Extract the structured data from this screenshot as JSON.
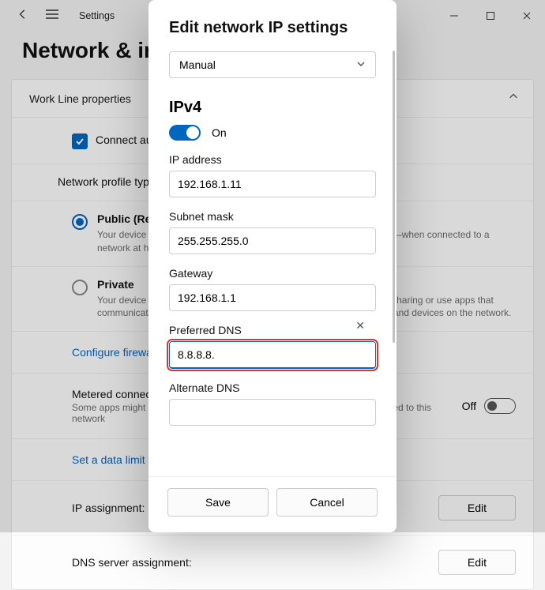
{
  "titlebar": {
    "app_label": "Settings"
  },
  "page": {
    "header": "Network & internet  ›  Work Line"
  },
  "card": {
    "title": "Work Line properties",
    "connect_auto": "Connect automatically when in range",
    "profile_label": "Network profile type",
    "public": {
      "title": "Public (Recommended)",
      "sub": "Your device is not discoverable on the network. Use this in most cases—when connected to a network at home, work, or in a public place."
    },
    "private": {
      "title": "Private",
      "sub": "Your device is discoverable on the network. Select this if you need file sharing or use apps that communicate over this network. You should know and trust the people and devices on the network."
    },
    "firewall_link": "Configure firewall and security settings",
    "metered": {
      "title": "Metered connection",
      "sub": "Some apps might work differently to reduce data usage when you're connected to this network"
    },
    "off_label": "Off",
    "data_limit_link": "Set a data limit to help control data usage on this network",
    "ip_assign_label": "IP assignment:",
    "dns_assign_label": "DNS server assignment:",
    "edit_btn": "Edit"
  },
  "modal": {
    "title": "Edit network IP settings",
    "mode": "Manual",
    "ipv4_heading": "IPv4",
    "on_label": "On",
    "ip_address_label": "IP address",
    "ip_address_value": "192.168.1.11",
    "subnet_label": "Subnet mask",
    "subnet_value": "255.255.255.0",
    "gateway_label": "Gateway",
    "gateway_value": "192.168.1.1",
    "pref_dns_label": "Preferred DNS",
    "pref_dns_value": "8.8.8.8.",
    "alt_dns_label": "Alternate DNS",
    "alt_dns_value": "",
    "save": "Save",
    "cancel": "Cancel"
  }
}
